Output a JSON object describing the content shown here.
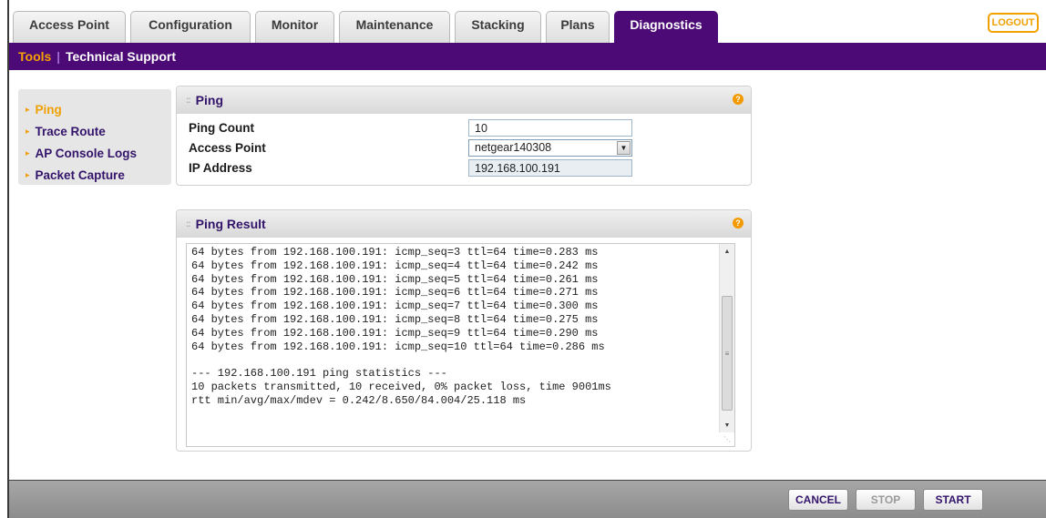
{
  "tabs": [
    {
      "label": "Access Point"
    },
    {
      "label": "Configuration"
    },
    {
      "label": "Monitor"
    },
    {
      "label": "Maintenance"
    },
    {
      "label": "Stacking"
    },
    {
      "label": "Plans"
    },
    {
      "label": "Diagnostics",
      "active": true
    }
  ],
  "logout_label": "LOGOUT",
  "subnav": {
    "tools": "Tools",
    "separator": "|",
    "technical_support": "Technical Support"
  },
  "sidemenu": [
    {
      "label": "Ping",
      "active": true
    },
    {
      "label": "Trace Route"
    },
    {
      "label": "AP Console Logs"
    },
    {
      "label": "Packet Capture"
    }
  ],
  "ping_panel": {
    "title": "Ping",
    "help_icon": "question-icon",
    "ping_count_label": "Ping Count",
    "ping_count_value": "10",
    "access_point_label": "Access Point",
    "access_point_value": "netgear140308",
    "ip_address_label": "IP Address",
    "ip_address_value": "192.168.100.191"
  },
  "result_panel": {
    "title": "Ping Result",
    "lines": [
      "64 bytes from 192.168.100.191: icmp_seq=3 ttl=64 time=0.283 ms",
      "64 bytes from 192.168.100.191: icmp_seq=4 ttl=64 time=0.242 ms",
      "64 bytes from 192.168.100.191: icmp_seq=5 ttl=64 time=0.261 ms",
      "64 bytes from 192.168.100.191: icmp_seq=6 ttl=64 time=0.271 ms",
      "64 bytes from 192.168.100.191: icmp_seq=7 ttl=64 time=0.300 ms",
      "64 bytes from 192.168.100.191: icmp_seq=8 ttl=64 time=0.275 ms",
      "64 bytes from 192.168.100.191: icmp_seq=9 ttl=64 time=0.290 ms",
      "64 bytes from 192.168.100.191: icmp_seq=10 ttl=64 time=0.286 ms",
      "",
      "--- 192.168.100.191 ping statistics ---",
      "10 packets transmitted, 10 received, 0% packet loss, time 9001ms",
      "rtt min/avg/max/mdev = 0.242/8.650/84.004/25.118 ms"
    ]
  },
  "footer": {
    "cancel": "CANCEL",
    "stop": "STOP",
    "start": "START"
  },
  "colors": {
    "brand_purple": "#4b0a76",
    "accent_orange": "#f0a000"
  }
}
